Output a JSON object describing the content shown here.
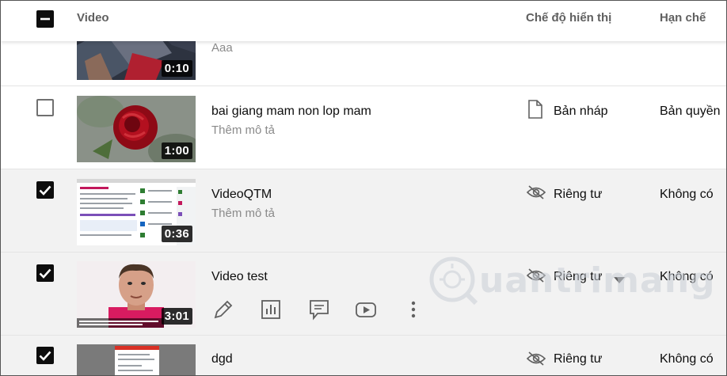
{
  "header": {
    "col_video": "Video",
    "col_visibility": "Chế độ hiển thị",
    "col_restrictions": "Hạn chế"
  },
  "rows": [
    {
      "title": "",
      "description": "Aaa",
      "duration": "0:10",
      "visibility": "",
      "restriction": "",
      "checked": true
    },
    {
      "title": "bai giang mam non lop mam",
      "description": "Thêm mô tả",
      "duration": "1:00",
      "visibility": "Bản nháp",
      "visibility_icon": "draft-document-icon",
      "restriction": "Bản quyền",
      "checked": false
    },
    {
      "title": "VideoQTM",
      "description": "Thêm mô tả",
      "duration": "0:36",
      "visibility": "Riêng tư",
      "visibility_icon": "eye-off-icon",
      "restriction": "Không có",
      "checked": true
    },
    {
      "title": "Video test",
      "duration": "3:01",
      "visibility": "Riêng tư",
      "visibility_icon": "eye-off-icon",
      "restriction": "Không có",
      "checked": true,
      "actions": [
        "edit-icon",
        "analytics-icon",
        "comments-icon",
        "youtube-icon",
        "more-options-icon"
      ]
    },
    {
      "title": "dgd",
      "duration": "",
      "visibility": "Riêng tư",
      "visibility_icon": "eye-off-icon",
      "restriction": "Không có",
      "checked": true
    }
  ],
  "watermark": {
    "text": "uantrimang"
  },
  "colors": {
    "checkbox": "#0d0d0d",
    "selected_row_bg": "#f2f2f2",
    "secondary_text": "#8a8a8a"
  }
}
